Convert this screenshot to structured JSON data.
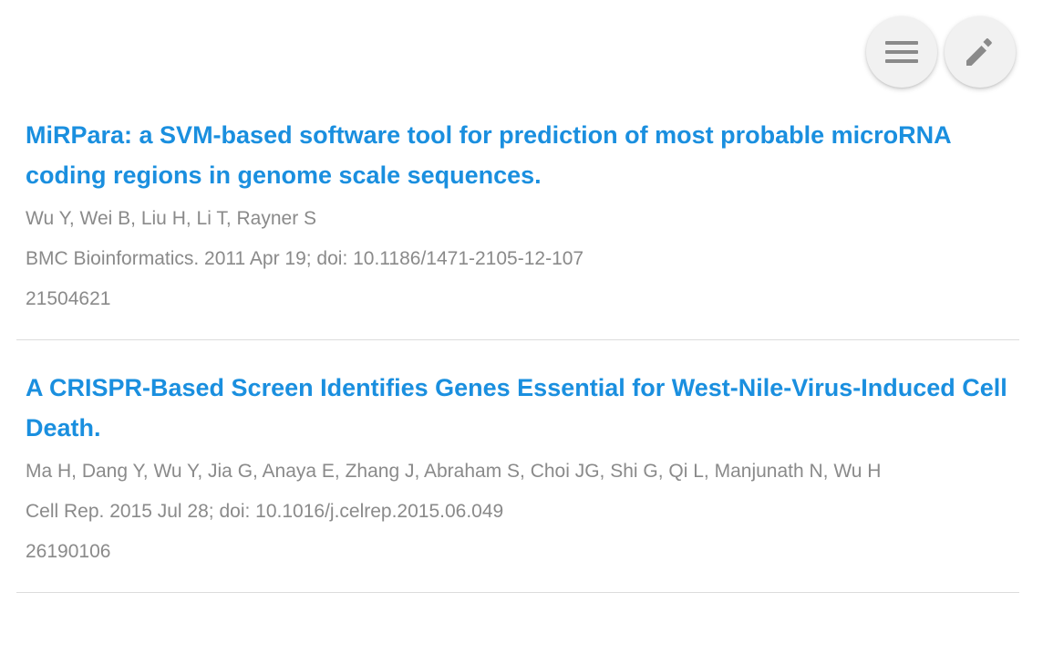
{
  "toolbar": {
    "menu_icon": "menu-icon",
    "edit_icon": "pencil-icon",
    "icon_color": "#8a8a8a"
  },
  "colors": {
    "title_link": "#1a8fdf",
    "meta_text": "#8a8a8a",
    "divider": "#dcdcdc"
  },
  "publications": [
    {
      "title": "MiRPara: a SVM-based software tool for prediction of most probable microRNA coding regions in genome scale sequences.",
      "authors": "Wu Y, Wei B, Liu H, Li T, Rayner S",
      "citation": "BMC Bioinformatics. 2011 Apr 19; doi: 10.1186/1471-2105-12-107",
      "pmid": "21504621"
    },
    {
      "title": "A CRISPR-Based Screen Identifies Genes Essential for West-Nile-Virus-Induced Cell Death.",
      "authors": "Ma H, Dang Y, Wu Y, Jia G, Anaya E, Zhang J, Abraham S, Choi JG, Shi G, Qi L, Manjunath N, Wu H",
      "citation": "Cell Rep. 2015 Jul 28; doi: 10.1016/j.celrep.2015.06.049",
      "pmid": "26190106"
    }
  ]
}
